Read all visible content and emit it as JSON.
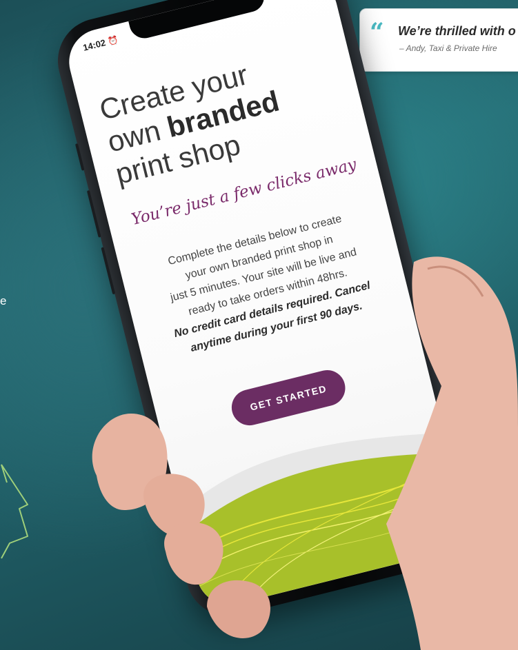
{
  "background": {
    "left_fragment": "e"
  },
  "testimonial": {
    "quote": "We’re thrilled with o",
    "author": "– Andy, Taxi & Private Hire"
  },
  "status_bar": {
    "time": "14:02"
  },
  "screen": {
    "headline_line1": "Create your",
    "headline_line2_pre": "own ",
    "headline_line2_bold": "branded",
    "headline_line3": "print shop",
    "subheading": "You’re just a few clicks away",
    "body_lines": [
      "Complete the details below to create",
      "your own branded print shop in",
      "just 5 minutes. Your site will be live and",
      "ready to take orders within 48hrs."
    ],
    "body_bold_lines": [
      "No credit card details required. Cancel",
      "anytime during your first 90 days."
    ],
    "cta_label": "GET STARTED"
  },
  "colors": {
    "accent_purple": "#6b2d63",
    "subhead_purple": "#7a2a6a",
    "quote_teal": "#4ab9c2",
    "wave_green": "#a8c02a",
    "wave_yellow": "#e6e63a"
  }
}
